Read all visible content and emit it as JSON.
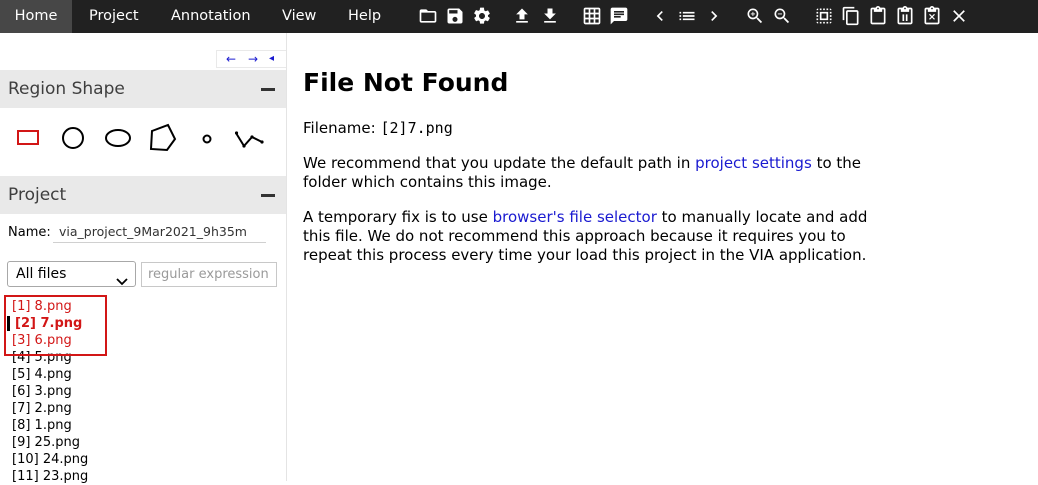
{
  "menubar": {
    "items": [
      "Home",
      "Project",
      "Annotation",
      "View",
      "Help"
    ]
  },
  "toolbar": {
    "icons": [
      "folder-open-icon",
      "save-icon",
      "gear-icon",
      "upload-icon",
      "download-icon",
      "grid-icon",
      "comment-icon",
      "prev-icon",
      "list-icon",
      "next-icon",
      "zoom-in-icon",
      "zoom-out-icon",
      "select-all-icon",
      "copy-icon",
      "paste-icon",
      "paste-special-icon",
      "delete-icon",
      "close-icon"
    ]
  },
  "nav_arrows": {
    "left": "←",
    "right": "→",
    "collapse": "◂"
  },
  "region_shape": {
    "title": "Region Shape",
    "shapes": [
      "rectangle",
      "circle",
      "ellipse",
      "polygon",
      "point",
      "polyline"
    ],
    "selected_color": "#d21616"
  },
  "project": {
    "title": "Project",
    "name_label": "Name:",
    "name_value": "via_project_9Mar2021_9h35m",
    "filter_selected": "All files",
    "regex_placeholder": "regular expression",
    "files": [
      "[1] 8.png",
      "[2] 7.png",
      "[3] 6.png",
      "[4] 5.png",
      "[5] 4.png",
      "[6] 3.png",
      "[7] 2.png",
      "[8] 1.png",
      "[9] 25.png",
      "[10] 24.png",
      "[11] 23.png"
    ],
    "current_index": 1,
    "highlight_color": "#d21616"
  },
  "main": {
    "title": "File Not Found",
    "filename_label": "Filename:",
    "filename_value": "[2]7.png",
    "p1_before": "We recommend that you update the default path in",
    "p1_link": "project settings",
    "p1_after": "to the folder which contains this image.",
    "p2_before": "A temporary fix is to use",
    "p2_link": "browser's file selector",
    "p2_after": "to manually locate and add this file. We do not recommend this approach because it requires you to repeat this process every time your load this project in the VIA application.",
    "link_color": "#1a1ad0"
  }
}
